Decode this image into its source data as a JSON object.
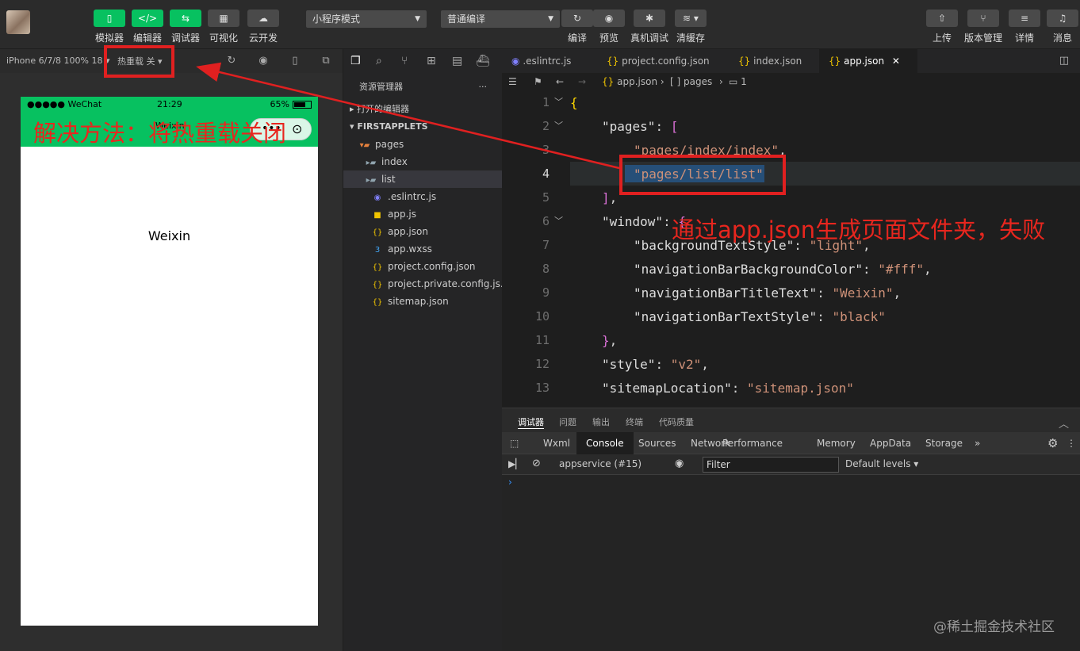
{
  "toolbar": {
    "buttons": [
      {
        "label": "模拟器",
        "icon": "phone-icon"
      },
      {
        "label": "编辑器",
        "icon": "code-icon"
      },
      {
        "label": "调试器",
        "icon": "debug-icon"
      },
      {
        "label": "可视化",
        "icon": "layout-icon"
      },
      {
        "label": "云开发",
        "icon": "cloud-icon"
      }
    ],
    "mode_select": "小程序模式",
    "compile_select": "普通编译",
    "actions": [
      {
        "label": "编译",
        "icon": "refresh-icon"
      },
      {
        "label": "预览",
        "icon": "eye-icon"
      },
      {
        "label": "真机调试",
        "icon": "bug-icon"
      },
      {
        "label": "清缓存",
        "icon": "layers-icon"
      }
    ],
    "right_actions": [
      {
        "label": "上传",
        "icon": "upload-icon"
      },
      {
        "label": "版本管理",
        "icon": "branch-icon"
      },
      {
        "label": "详情",
        "icon": "menu-icon"
      },
      {
        "label": "消息",
        "icon": "bell-icon"
      }
    ]
  },
  "simulator": {
    "device": "iPhone 6/7/8 100% 18",
    "hot_reload": "热重载 关",
    "status_left": "●●●●● WeChat",
    "status_time": "21:29",
    "status_battery": "65%",
    "nav_title": "Weixin",
    "page_text": "Weixin"
  },
  "explorer": {
    "title": "资源管理器",
    "open_editors": "打开的编辑器",
    "project": "FIRSTAPPLETS",
    "items": [
      {
        "label": "pages"
      },
      {
        "label": "index"
      },
      {
        "label": "list"
      },
      {
        "label": ".eslintrc.js"
      },
      {
        "label": "app.js"
      },
      {
        "label": "app.json"
      },
      {
        "label": "app.wxss"
      },
      {
        "label": "project.config.json"
      },
      {
        "label": "project.private.config.js..."
      },
      {
        "label": "sitemap.json"
      }
    ]
  },
  "editor": {
    "tabs": [
      ".eslintrc.js",
      "project.config.json",
      "index.json",
      "app.json"
    ],
    "breadcrumb": [
      "app.json",
      "[ ] pages",
      "1"
    ],
    "line_numbers": [
      "1",
      "2",
      "3",
      "4",
      "5",
      "6",
      "7",
      "8",
      "9",
      "10",
      "11",
      "12",
      "13"
    ],
    "code": {
      "l2_key": "\"pages\"",
      "l3": "\"pages/index/index\"",
      "l4": "\"pages/list/list\"",
      "l6_key": "\"window\"",
      "l7_key": "\"backgroundTextStyle\"",
      "l7_val": "\"light\"",
      "l8_key": "\"navigationBarBackgroundColor\"",
      "l8_val": "\"#fff\"",
      "l9_key": "\"navigationBarTitleText\"",
      "l9_val": "\"Weixin\"",
      "l10_key": "\"navigationBarTextStyle\"",
      "l10_val": "\"black\"",
      "l12_key": "\"style\"",
      "l12_val": "\"v2\"",
      "l13_key": "\"sitemapLocation\"",
      "l13_val": "\"sitemap.json\""
    }
  },
  "debugger": {
    "panel_tabs": [
      "调试器",
      "问题",
      "输出",
      "终端",
      "代码质量"
    ],
    "dev_tabs": [
      "Wxml",
      "Console",
      "Sources",
      "Network",
      "Performance",
      "Memory",
      "AppData",
      "Storage"
    ],
    "context": "appservice (#15)",
    "filter_placeholder": "Filter",
    "levels": "Default levels"
  },
  "annotations": {
    "left": "解决方法：将热重载关闭",
    "right": "通过app.json生成页面文件夹，失败"
  },
  "watermark": "@稀土掘金技术社区",
  "colors": {
    "accent": "#07c160",
    "annotation": "#e02020"
  }
}
